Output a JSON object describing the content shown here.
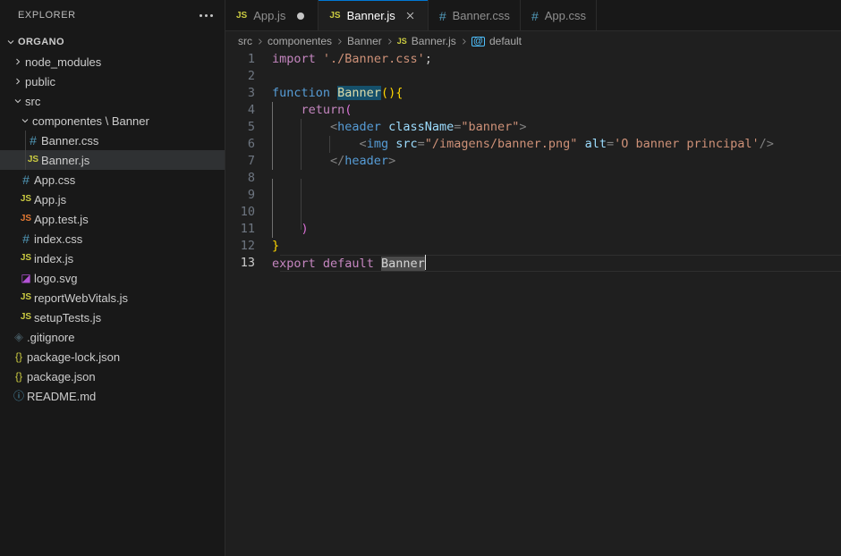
{
  "sidebar": {
    "title": "EXPLORER",
    "more_actions_icon": "ellipsis-icon",
    "root": {
      "label": "ORGANO",
      "expanded": true,
      "chevron": "chevron-down-icon"
    },
    "items": [
      {
        "label": "node_modules",
        "type": "folder",
        "icon": "chevron-right-icon",
        "indent": 1,
        "expanded": false,
        "selected": false
      },
      {
        "label": "public",
        "type": "folder",
        "icon": "chevron-right-icon",
        "indent": 1,
        "expanded": false,
        "selected": false
      },
      {
        "label": "src",
        "type": "folder",
        "icon": "chevron-down-icon",
        "indent": 1,
        "expanded": true,
        "selected": false
      },
      {
        "label": "componentes \\ Banner",
        "type": "folder",
        "icon": "chevron-down-icon",
        "indent": 2,
        "expanded": true,
        "selected": false
      },
      {
        "label": "Banner.css",
        "type": "css",
        "icon": "css-file-icon",
        "glyph": "#",
        "indent": 3,
        "selected": false
      },
      {
        "label": "Banner.js",
        "type": "js",
        "icon": "js-file-icon",
        "glyph": "JS",
        "indent": 3,
        "selected": true
      },
      {
        "label": "App.css",
        "type": "css",
        "icon": "css-file-icon",
        "glyph": "#",
        "indent": 2,
        "selected": false
      },
      {
        "label": "App.js",
        "type": "js",
        "icon": "js-file-icon",
        "glyph": "JS",
        "indent": 2,
        "selected": false
      },
      {
        "label": "App.test.js",
        "type": "jstest",
        "icon": "js-test-file-icon",
        "glyph": "JS",
        "indent": 2,
        "selected": false
      },
      {
        "label": "index.css",
        "type": "css",
        "icon": "css-file-icon",
        "glyph": "#",
        "indent": 2,
        "selected": false
      },
      {
        "label": "index.js",
        "type": "js",
        "icon": "js-file-icon",
        "glyph": "JS",
        "indent": 2,
        "selected": false
      },
      {
        "label": "logo.svg",
        "type": "svg",
        "icon": "svg-file-icon",
        "glyph": "◪",
        "indent": 2,
        "selected": false
      },
      {
        "label": "reportWebVitals.js",
        "type": "js",
        "icon": "js-file-icon",
        "glyph": "JS",
        "indent": 2,
        "selected": false
      },
      {
        "label": "setupTests.js",
        "type": "js",
        "icon": "js-file-icon",
        "glyph": "JS",
        "indent": 2,
        "selected": false
      },
      {
        "label": ".gitignore",
        "type": "git",
        "icon": "git-file-icon",
        "glyph": "◈",
        "indent": 1,
        "selected": false
      },
      {
        "label": "package-lock.json",
        "type": "json",
        "icon": "json-file-icon",
        "glyph": "{}",
        "indent": 1,
        "selected": false
      },
      {
        "label": "package.json",
        "type": "json",
        "icon": "json-file-icon",
        "glyph": "{}",
        "indent": 1,
        "selected": false
      },
      {
        "label": "README.md",
        "type": "md",
        "icon": "info-file-icon",
        "glyph": "ⓘ",
        "indent": 1,
        "selected": false
      }
    ]
  },
  "tabs": [
    {
      "label": "App.js",
      "icon": "js-file-icon",
      "glyph": "JS",
      "active": false,
      "dirty": true,
      "closable": false
    },
    {
      "label": "Banner.js",
      "icon": "js-file-icon",
      "glyph": "JS",
      "active": true,
      "dirty": false,
      "closable": true,
      "close_icon": "close-icon"
    },
    {
      "label": "Banner.css",
      "icon": "css-file-icon",
      "glyph": "#",
      "active": false,
      "dirty": false,
      "closable": false
    },
    {
      "label": "App.css",
      "icon": "css-file-icon",
      "glyph": "#",
      "active": false,
      "dirty": false,
      "closable": false
    }
  ],
  "breadcrumb": {
    "items": [
      {
        "label": "src",
        "icon": null
      },
      {
        "label": "componentes",
        "icon": null
      },
      {
        "label": "Banner",
        "icon": null
      },
      {
        "label": "Banner.js",
        "icon": "js-file-icon",
        "glyph": "JS"
      },
      {
        "label": "default",
        "icon": "symbol-class-icon",
        "glyph": "@"
      }
    ],
    "separator": "›"
  },
  "editor": {
    "active_line": 13,
    "total_lines": 13,
    "cursor_line": 13,
    "lines": [
      {
        "n": "1",
        "text": "import './Banner.css';"
      },
      {
        "n": "2",
        "text": ""
      },
      {
        "n": "3",
        "text": "function Banner(){"
      },
      {
        "n": "4",
        "text": "    return("
      },
      {
        "n": "5",
        "text": "        <header className=\"banner\">"
      },
      {
        "n": "6",
        "text": "            <img src=\"/imagens/banner.png\" alt='O banner principal'/>"
      },
      {
        "n": "7",
        "text": "        </header>"
      },
      {
        "n": "8",
        "text": ""
      },
      {
        "n": "9",
        "text": ""
      },
      {
        "n": "10",
        "text": ""
      },
      {
        "n": "11",
        "text": "    )"
      },
      {
        "n": "12",
        "text": "}"
      },
      {
        "n": "13",
        "text": "export default Banner"
      }
    ],
    "tokens": {
      "l1_import": "import",
      "l1_string": "'./Banner.css'",
      "l1_semi": ";",
      "l3_function": "function",
      "l3_name": "Banner",
      "l3_parens": "()",
      "l3_brace": "{",
      "l4_return": "return",
      "l4_paren": "(",
      "l5_open": "<",
      "l5_tag": "header",
      "l5_attr": "className",
      "l5_eq": "=",
      "l5_val": "\"banner\"",
      "l5_close": ">",
      "l6_open": "<",
      "l6_tag": "img",
      "l6_attr1": "src",
      "l6_val1": "\"/imagens/banner.png\"",
      "l6_attr2": "alt",
      "l6_val2": "'O banner principal'",
      "l6_selfclose": "/>",
      "l7_open": "</",
      "l7_tag": "header",
      "l7_close": ">",
      "l11_paren": ")",
      "l12_brace": "}",
      "l13_export": "export",
      "l13_default": "default",
      "l13_name": "Banner"
    },
    "selections": {
      "line3_word": "Banner",
      "line13_word": "Banner"
    }
  },
  "colors": {
    "sidebar_bg": "#181818",
    "editor_bg": "#1f1f1f",
    "tab_active_bg": "#1f1f1f",
    "tab_accent": "#0078d4",
    "selection_blue": "#15506b",
    "selection_gray": "#4a4a4a",
    "keyword_purple": "#c586c0",
    "keyword_blue": "#569cd6",
    "string_orange": "#ce9178",
    "attr_lightblue": "#9cdcfe",
    "bracket_yellow": "#ffd700",
    "bracket_magenta": "#da70d6",
    "line_number": "#6e7681",
    "text_primary": "#cccccc",
    "js_icon": "#cbcb41",
    "css_icon": "#519aba"
  }
}
